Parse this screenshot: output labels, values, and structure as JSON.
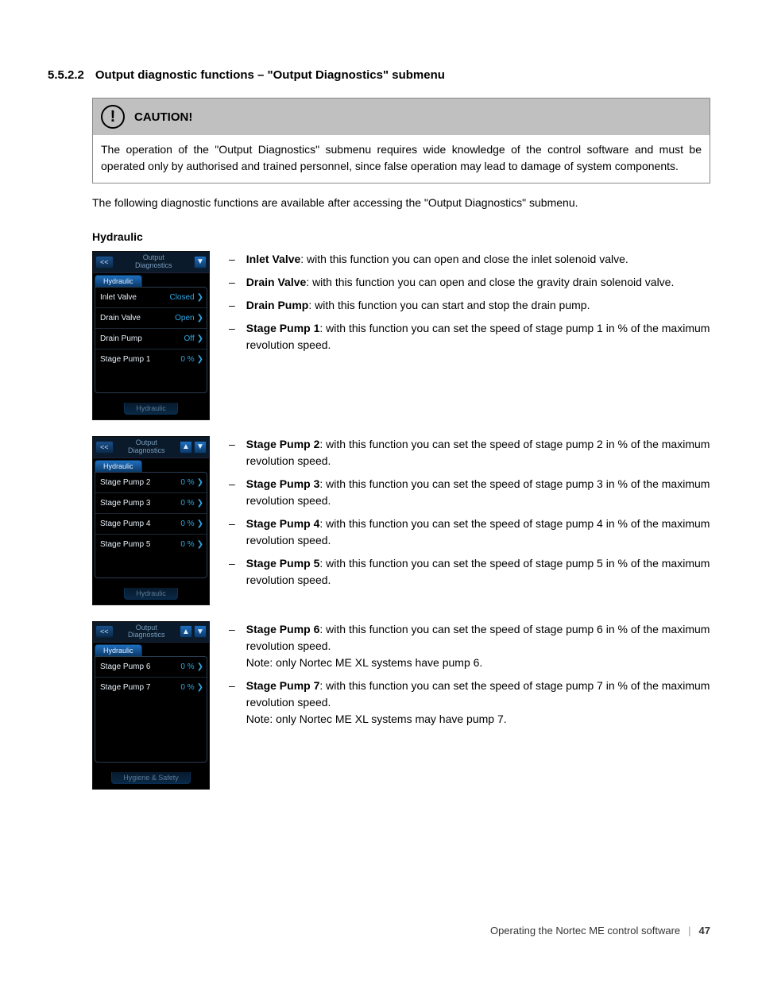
{
  "section": {
    "number": "5.5.2.2",
    "title": "Output diagnostic functions – \"Output Diagnostics\" submenu"
  },
  "caution": {
    "label": "CAUTION!",
    "body": "The operation of the \"Output Diagnostics\" submenu requires wide knowledge of the control software and must be operated only by authorised and trained personnel, since false operation may lead to damage of system components."
  },
  "intro": "The following diagnostic functions are available after accessing the \"Output Diagnostics\" submenu.",
  "subsection": "Hydraulic",
  "screens": [
    {
      "back": "<<",
      "title": "Output Diagnostics",
      "show_up": false,
      "show_down": true,
      "tab": "Hydraulic",
      "rows": [
        {
          "label": "Inlet Valve",
          "value": "Closed"
        },
        {
          "label": "Drain Valve",
          "value": "Open"
        },
        {
          "label": "Drain Pump",
          "value": "Off"
        },
        {
          "label": "Stage Pump 1",
          "value": "0 %"
        }
      ],
      "footer_tab": "Hydraulic",
      "footer_inactive": true
    },
    {
      "back": "<<",
      "title": "Output Diagnostics",
      "show_up": true,
      "show_down": true,
      "tab": "Hydraulic",
      "rows": [
        {
          "label": "Stage Pump 2",
          "value": "0 %"
        },
        {
          "label": "Stage Pump 3",
          "value": "0 %"
        },
        {
          "label": "Stage Pump 4",
          "value": "0 %"
        },
        {
          "label": "Stage Pump 5",
          "value": "0 %"
        }
      ],
      "footer_tab": "Hydraulic",
      "footer_inactive": true
    },
    {
      "back": "<<",
      "title": "Output Diagnostics",
      "show_up": true,
      "show_down": true,
      "tab": "Hydraulic",
      "rows": [
        {
          "label": "Stage Pump 6",
          "value": "0 %"
        },
        {
          "label": "Stage Pump 7",
          "value": "0 %"
        }
      ],
      "footer_tab": "Hygiene & Safety",
      "footer_inactive": true
    }
  ],
  "desc_groups": [
    [
      {
        "term": "Inlet Valve",
        "text": ": with this function you can open and close the inlet solenoid valve."
      },
      {
        "term": "Drain Valve",
        "text": ": with this function you can open and close the gravity drain solenoid valve."
      },
      {
        "term": "Drain Pump",
        "text": ": with this function you can start and stop the drain pump."
      },
      {
        "term": "Stage Pump 1",
        "text": ": with this function you can set the speed of stage pump 1 in % of the maximum revolution speed."
      }
    ],
    [
      {
        "term": "Stage Pump 2",
        "text": ": with this function you can set the speed of stage pump 2 in % of the maximum revolution speed."
      },
      {
        "term": "Stage Pump 3",
        "text": ": with this function you can set the speed of stage pump 3 in % of the maximum revolution speed."
      },
      {
        "term": "Stage Pump 4",
        "text": ": with this function you can set the speed of stage pump 4 in % of the maximum revolution speed."
      },
      {
        "term": "Stage Pump 5",
        "text": ": with this function you can set the speed of stage pump 5 in % of the maximum revolution speed."
      }
    ],
    [
      {
        "term": "Stage Pump 6",
        "text": ": with this function you can set the speed of stage pump 6 in % of the maximum revolution speed.",
        "note": "Note: only Nortec ME XL systems have pump 6."
      },
      {
        "term": "Stage Pump 7",
        "text": ": with this function you can set the speed of stage pump 7 in % of the maximum revolution speed.",
        "note": "Note: only Nortec ME XL systems may have pump 7."
      }
    ]
  ],
  "footer": {
    "text": "Operating the Nortec ME control software",
    "page": "47"
  }
}
